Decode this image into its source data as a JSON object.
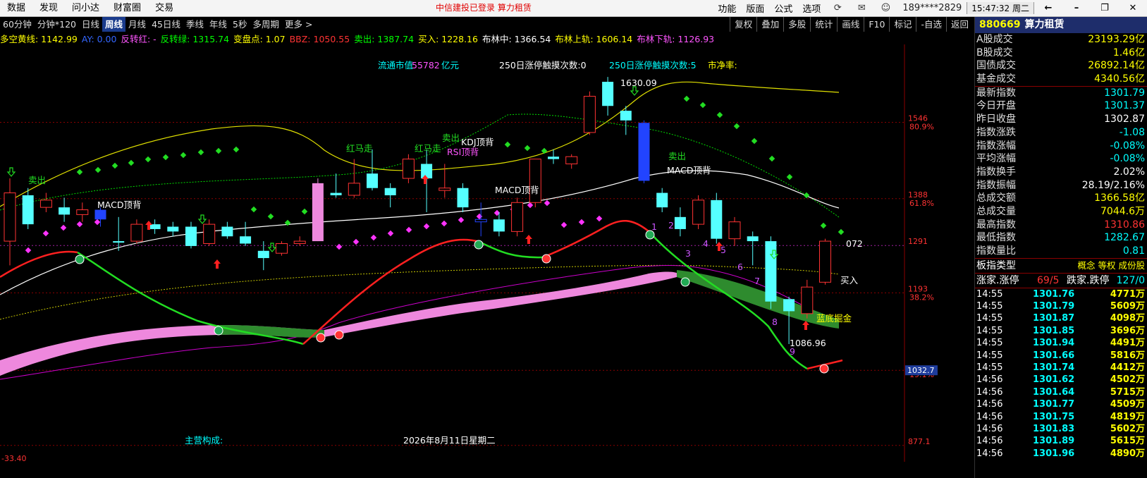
{
  "menu": [
    "数据",
    "发现",
    "问小达",
    "财富圈",
    "交易"
  ],
  "notice": "中信建投已登录  算力租赁",
  "top_right": [
    "功能",
    "版面",
    "公式",
    "选项"
  ],
  "account": "189****2829",
  "clock": "15:47:32 周二",
  "period_tabs": [
    {
      "label": "60分钟",
      "selected": false
    },
    {
      "label": "分钟*120",
      "selected": false
    },
    {
      "label": "日线",
      "selected": false
    },
    {
      "label": "周线",
      "selected": true
    },
    {
      "label": "月线",
      "selected": false
    },
    {
      "label": "45日线",
      "selected": false
    },
    {
      "label": "季线",
      "selected": false
    },
    {
      "label": "年线",
      "selected": false
    },
    {
      "label": "5秒",
      "selected": false
    },
    {
      "label": "多周期",
      "selected": false
    },
    {
      "label": "更多 >",
      "selected": false
    }
  ],
  "tools": [
    "复权",
    "叠加",
    "多股",
    "统计",
    "画线",
    "F10",
    "标记",
    "-自选",
    "返回"
  ],
  "indicators": [
    {
      "text": "多空黄线: 1142.99",
      "color": "#ffff00"
    },
    {
      "text": "AY: 0.00",
      "color": "#3366ff"
    },
    {
      "text": "反转红: -",
      "color": "#ff55ff"
    },
    {
      "text": "反转绿: 1315.74",
      "color": "#00ff00"
    },
    {
      "text": "变盘点: 1.07",
      "color": "#ffff00"
    },
    {
      "text": "BBZ: 1050.55",
      "color": "#ff3333"
    },
    {
      "text": "卖出: 1387.74",
      "color": "#00ff00"
    },
    {
      "text": "买入: 1228.16",
      "color": "#ffff00"
    },
    {
      "text": "布林中: 1366.54",
      "color": "#ffffff"
    },
    {
      "text": "布林上轨: 1606.14",
      "color": "#ffff00"
    },
    {
      "text": "布林下轨: 1126.93",
      "color": "#ff55ff"
    }
  ],
  "chart_labels": {
    "market_value_label": "流通市值",
    "market_value": "55782",
    "market_value_unit": "亿元",
    "limit_touch_1": "250日涨停触摸次数:0",
    "limit_touch_2": "250日涨停触摸次数:5",
    "pb": "市净率:",
    "main_business": "主营构成:",
    "date": "2026年8月11日星期二",
    "high_label": "1630.09",
    "low_label": "1086.96",
    "last_label": "072",
    "buy": "买入",
    "blue_bottom": "蓝底掘金",
    "macd1": "MACD顶背",
    "macd2": "MACD顶背",
    "macd3": "MACD顶背",
    "kdj": "KDJ顶背",
    "rsi": "RSI顶背",
    "sell1": "卖出",
    "sell2": "卖出",
    "sell3": "卖出",
    "red_horse1": "红马走",
    "red_horse2": "红马走",
    "bottom_value": "-33.40",
    "cursor_price": "1032.7"
  },
  "axis": [
    {
      "price": "1546",
      "pct": "80.9%"
    },
    {
      "price": "1388",
      "pct": "61.8%"
    },
    {
      "price": "1291",
      "pct": ""
    },
    {
      "price": "1193",
      "pct": "38.2%"
    },
    {
      "price": "",
      "pct": "19.1%"
    },
    {
      "price": "877.1",
      "pct": ""
    }
  ],
  "counts": [
    "1",
    "2",
    "3",
    "4",
    "5",
    "6",
    "7",
    "8",
    "9"
  ],
  "panel": {
    "code": "880669",
    "name": "算力租赁",
    "market": [
      {
        "k": "A股成交",
        "v": "23193.29亿",
        "c": "#ffff00"
      },
      {
        "k": "B股成交",
        "v": "1.46亿",
        "c": "#ffff00"
      },
      {
        "k": "国债成交",
        "v": "26892.14亿",
        "c": "#ffff00"
      },
      {
        "k": "基金成交",
        "v": "4340.56亿",
        "c": "#ffff00"
      }
    ],
    "stats": [
      {
        "k": "最新指数",
        "v": "1301.79",
        "c": "#00ffff"
      },
      {
        "k": "今日开盘",
        "v": "1301.37",
        "c": "#00ffff"
      },
      {
        "k": "昨日收盘",
        "v": "1302.87",
        "c": "#ffffff"
      },
      {
        "k": "指数涨跌",
        "v": "-1.08",
        "c": "#00ffff"
      },
      {
        "k": "指数涨幅",
        "v": "-0.08%",
        "c": "#00ffff"
      },
      {
        "k": "平均涨幅",
        "v": "-0.08%",
        "c": "#00ffff"
      },
      {
        "k": "指数换手",
        "v": "2.02%",
        "c": "#ffffff"
      },
      {
        "k": "指数振幅",
        "v": "28.19/2.16%",
        "c": "#ffffff"
      },
      {
        "k": "总成交额",
        "v": "1366.58亿",
        "c": "#ffff00"
      },
      {
        "k": "总成交量",
        "v": "7044.6万",
        "c": "#ffff00"
      },
      {
        "k": "最高指数",
        "v": "1310.86",
        "c": "#ff3333"
      },
      {
        "k": "最低指数",
        "v": "1282.67",
        "c": "#00ffff"
      },
      {
        "k": "指数量比",
        "v": "0.81",
        "c": "#00ffff"
      }
    ],
    "type_label": "板指类型",
    "type_value": "概念 等权 成份股",
    "up_label": "涨家.涨停",
    "up_value": "69/5",
    "down_label": "跌家.跌停",
    "down_value": "127/0",
    "ticks": [
      {
        "t": "14:55",
        "p": "1301.76",
        "v": "4771万"
      },
      {
        "t": "14:55",
        "p": "1301.79",
        "v": "5609万"
      },
      {
        "t": "14:55",
        "p": "1301.87",
        "v": "4098万"
      },
      {
        "t": "14:55",
        "p": "1301.85",
        "v": "3696万"
      },
      {
        "t": "14:55",
        "p": "1301.94",
        "v": "4491万"
      },
      {
        "t": "14:55",
        "p": "1301.66",
        "v": "5816万"
      },
      {
        "t": "14:55",
        "p": "1301.74",
        "v": "4412万"
      },
      {
        "t": "14:56",
        "p": "1301.62",
        "v": "4502万"
      },
      {
        "t": "14:56",
        "p": "1301.64",
        "v": "5715万"
      },
      {
        "t": "14:56",
        "p": "1301.77",
        "v": "4509万"
      },
      {
        "t": "14:56",
        "p": "1301.75",
        "v": "4819万"
      },
      {
        "t": "14:56",
        "p": "1301.83",
        "v": "5602万"
      },
      {
        "t": "14:56",
        "p": "1301.89",
        "v": "5615万"
      },
      {
        "t": "14:56",
        "p": "1301.96",
        "v": "4890万"
      }
    ]
  },
  "candles": [
    {
      "o": 1300,
      "c": 1400,
      "h": 1430,
      "l": 1250
    },
    {
      "o": 1395,
      "c": 1335,
      "h": 1410,
      "l": 1325
    },
    {
      "o": 1370,
      "c": 1385,
      "h": 1400,
      "l": 1360
    },
    {
      "o": 1370,
      "c": 1355,
      "h": 1390,
      "l": 1340
    },
    {
      "o": 1355,
      "c": 1365,
      "h": 1380,
      "l": 1340
    },
    {
      "o": 1365,
      "c": 1345,
      "h": 1370,
      "l": 1330
    },
    {
      "o": 1300,
      "c": 1297,
      "h": 1350,
      "l": 1280
    },
    {
      "o": 1300,
      "c": 1335,
      "h": 1345,
      "l": 1295
    },
    {
      "o": 1335,
      "c": 1325,
      "h": 1345,
      "l": 1315
    },
    {
      "o": 1330,
      "c": 1320,
      "h": 1340,
      "l": 1310
    },
    {
      "o": 1330,
      "c": 1290,
      "h": 1340,
      "l": 1285
    },
    {
      "o": 1295,
      "c": 1335,
      "h": 1345,
      "l": 1290
    },
    {
      "o": 1330,
      "c": 1310,
      "h": 1340,
      "l": 1305
    },
    {
      "o": 1310,
      "c": 1295,
      "h": 1340,
      "l": 1290
    },
    {
      "o": 1280,
      "c": 1265,
      "h": 1300,
      "l": 1240
    },
    {
      "o": 1275,
      "c": 1295,
      "h": 1300,
      "l": 1270
    },
    {
      "o": 1295,
      "c": 1300,
      "h": 1310,
      "l": 1290
    },
    {
      "o": 1300,
      "c": 1420,
      "h": 1430,
      "l": 1300
    },
    {
      "o": 1400,
      "c": 1395,
      "h": 1440,
      "l": 1390
    },
    {
      "o": 1395,
      "c": 1420,
      "h": 1470,
      "l": 1390
    },
    {
      "o": 1440,
      "c": 1410,
      "h": 1490,
      "l": 1405
    },
    {
      "o": 1410,
      "c": 1395,
      "h": 1420,
      "l": 1370
    },
    {
      "o": 1430,
      "c": 1470,
      "h": 1480,
      "l": 1420
    },
    {
      "o": 1460,
      "c": 1430,
      "h": 1490,
      "l": 1360
    },
    {
      "o": 1405,
      "c": 1410,
      "h": 1460,
      "l": 1390
    },
    {
      "o": 1410,
      "c": 1370,
      "h": 1420,
      "l": 1360
    },
    {
      "o": 1340,
      "c": 1345,
      "h": 1380,
      "l": 1310
    },
    {
      "o": 1345,
      "c": 1320,
      "h": 1360,
      "l": 1310
    },
    {
      "o": 1320,
      "c": 1380,
      "h": 1390,
      "l": 1310
    },
    {
      "o": 1380,
      "c": 1470,
      "h": 1470,
      "l": 1370
    },
    {
      "o": 1475,
      "c": 1470,
      "h": 1490,
      "l": 1460
    },
    {
      "o": 1460,
      "c": 1475,
      "h": 1480,
      "l": 1450
    },
    {
      "o": 1525,
      "c": 1600,
      "h": 1610,
      "l": 1520
    },
    {
      "o": 1630,
      "c": 1580,
      "h": 1640,
      "l": 1560
    },
    {
      "o": 1570,
      "c": 1550,
      "h": 1580,
      "l": 1520
    },
    {
      "o": 1545,
      "c": 1425,
      "h": 1550,
      "l": 1420
    },
    {
      "o": 1400,
      "c": 1370,
      "h": 1410,
      "l": 1360
    },
    {
      "o": 1350,
      "c": 1325,
      "h": 1370,
      "l": 1310
    },
    {
      "o": 1335,
      "c": 1385,
      "h": 1395,
      "l": 1325
    },
    {
      "o": 1385,
      "c": 1305,
      "h": 1400,
      "l": 1295
    },
    {
      "o": 1305,
      "c": 1340,
      "h": 1350,
      "l": 1290
    },
    {
      "o": 1310,
      "c": 1300,
      "h": 1320,
      "l": 1250
    },
    {
      "o": 1300,
      "c": 1175,
      "h": 1310,
      "l": 1160
    },
    {
      "o": 1180,
      "c": 1155,
      "h": 1185,
      "l": 1087
    },
    {
      "o": 1150,
      "c": 1205,
      "h": 1220,
      "l": 1140
    },
    {
      "o": 1215,
      "c": 1300,
      "h": 1305,
      "l": 1210
    }
  ],
  "blue_candle_idx": [
    5,
    26,
    35
  ],
  "pink_candle_idx": [
    17
  ]
}
